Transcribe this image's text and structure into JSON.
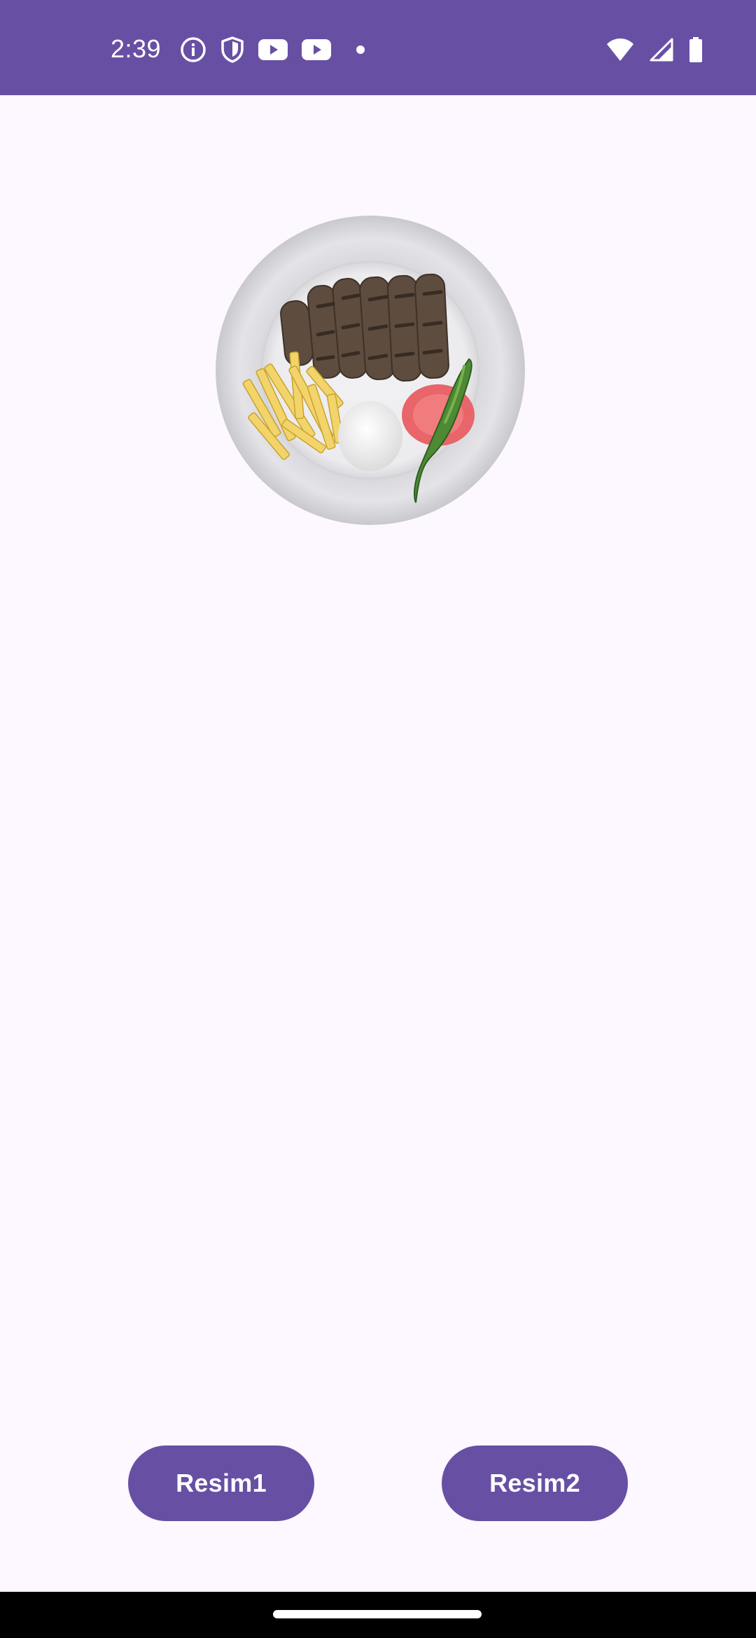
{
  "status_bar": {
    "time": "2:39",
    "background_color": "#6750A4",
    "left_icons": [
      "info-icon",
      "shield-icon",
      "youtube-icon",
      "youtube-icon",
      "dot-icon"
    ],
    "right_icons": [
      "wifi-icon",
      "cellular-signal-icon",
      "battery-icon"
    ]
  },
  "content": {
    "image": {
      "icon": "food-plate-image"
    }
  },
  "buttons": {
    "resim1_label": "Resim1",
    "resim2_label": "Resim2",
    "color": "#6750A4"
  },
  "theme": {
    "background": "#FDF7FF",
    "primary": "#6750A4",
    "on_primary": "#FFFFFF"
  }
}
